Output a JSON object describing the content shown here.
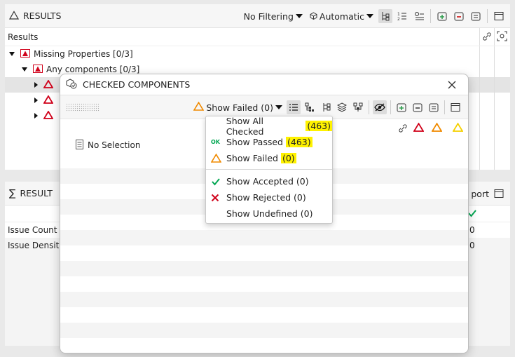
{
  "results_panel": {
    "title": "RESULTS",
    "filter_label": "No Filtering",
    "mode_label": "Automatic",
    "column_header": "Results",
    "tree": [
      {
        "label": "Missing Properties [0/3]"
      },
      {
        "label": "Any components [0/3]"
      }
    ]
  },
  "summary_panel": {
    "title": "RESULT",
    "right_label": "port",
    "rows": [
      {
        "label": "Issue Count",
        "value": "0"
      },
      {
        "label": "Issue Density",
        "value": "0"
      }
    ]
  },
  "dialog": {
    "title": "CHECKED COMPONENTS",
    "filter_label": "Show Failed (0)",
    "empty_text": "No Selection"
  },
  "menu": {
    "items": [
      {
        "text": "Show All Checked",
        "count": "(463)"
      },
      {
        "text": "Show Passed",
        "count": "(463)",
        "icon_text": "OK"
      },
      {
        "text": "Show Failed",
        "count": "(0)"
      },
      {
        "text": "Show Accepted (0)"
      },
      {
        "text": "Show Rejected (0)"
      },
      {
        "text": "Show Undefined (0)"
      }
    ]
  },
  "colors": {
    "error_red": "#d0021b",
    "warning_orange": "#f08a00",
    "caution_yellow": "#f5d000",
    "ok_green": "#00a651",
    "highlight": "#fff200",
    "accent_green": "#2a9a4a"
  }
}
